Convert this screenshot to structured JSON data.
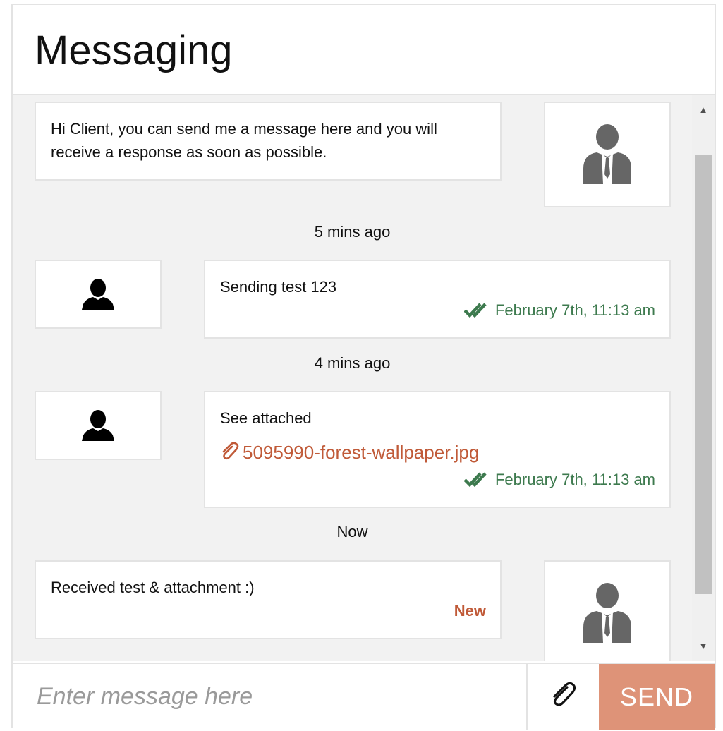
{
  "header": {
    "title": "Messaging"
  },
  "thread": {
    "messages": [
      {
        "text": "Hi Client, you can send me a message here and you will receive a response as soon as possible."
      },
      {
        "time_ago": "5 mins ago",
        "text": "Sending test 123",
        "timestamp": "February 7th, 11:13 am"
      },
      {
        "time_ago": "4 mins ago",
        "text": "See attached",
        "attachment": "5095990-forest-wallpaper.jpg",
        "timestamp": "February 7th, 11:13 am"
      },
      {
        "time_ago": "Now",
        "text": "Received test & attachment :)",
        "badge": "New"
      }
    ]
  },
  "composer": {
    "placeholder": "Enter message here",
    "send_label": "SEND"
  },
  "icons": {
    "agent_avatar": "businessman-avatar-icon",
    "client_avatar": "person-silhouette-icon",
    "read_receipt": "double-check-icon",
    "attachment": "paperclip-icon",
    "scroll_up": "arrow-up-icon",
    "scroll_down": "arrow-down-icon"
  },
  "colors": {
    "accent": "#c05a38",
    "send_button": "#de9378",
    "read_receipt": "#3d7a4e",
    "thread_background": "#f2f2f2"
  }
}
